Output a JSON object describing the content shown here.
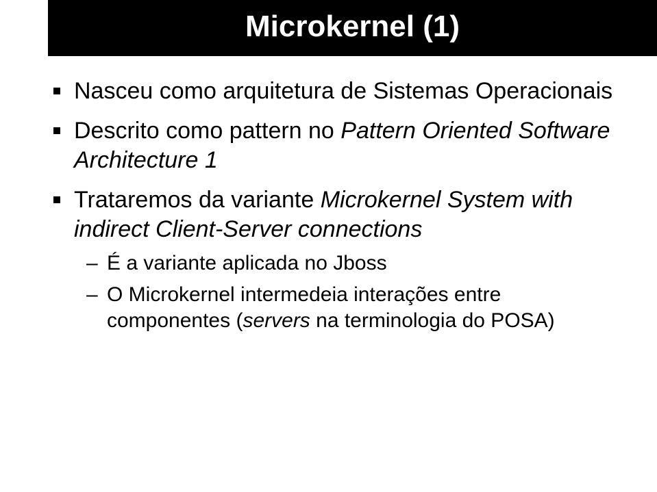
{
  "title": "Microkernel (1)",
  "bullets": {
    "b1": "Nasceu como arquitetura de Sistemas Operacionais",
    "b2_pre": "Descrito como pattern no ",
    "b2_ital": "Pattern Oriented Software Architecture 1",
    "b3_pre": "Trataremos da variante ",
    "b3_ital": "Microkernel System with indirect Client-Server connections",
    "b3_sub1": "É a variante aplicada no Jboss",
    "b3_sub2_pre": "O Microkernel intermedeia interações entre componentes (",
    "b3_sub2_ital": "servers",
    "b3_sub2_post": " na terminologia do POSA)"
  }
}
